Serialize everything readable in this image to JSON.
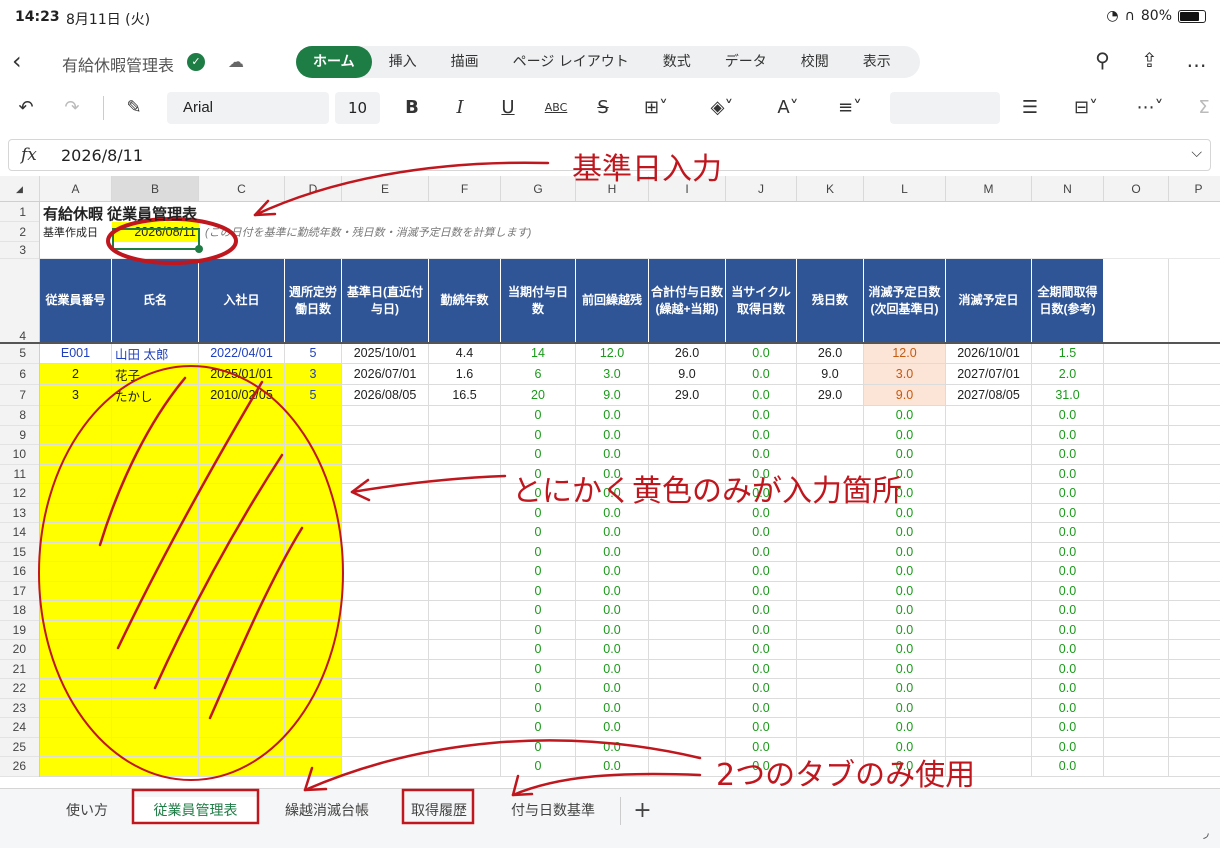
{
  "status": {
    "time": "14:23",
    "date": "8月11日 (火)",
    "battery": "80%",
    "battery_level": 0.8
  },
  "header": {
    "doc_title": "有給休暇管理表"
  },
  "ribbon": {
    "tabs": [
      "ホーム",
      "挿入",
      "描画",
      "ページ レイアウト",
      "数式",
      "データ",
      "校閲",
      "表示"
    ],
    "active_tab": "ホーム"
  },
  "toolbar": {
    "font": "Arial",
    "size": "10"
  },
  "formula_bar": {
    "fx": "fx",
    "value": "2026/8/11"
  },
  "columns": [
    "A",
    "B",
    "C",
    "D",
    "E",
    "F",
    "G",
    "H",
    "I",
    "J",
    "K",
    "L",
    "M",
    "N",
    "O",
    "P"
  ],
  "selected_column": "B",
  "sheet": {
    "title": "有給休暇 従業員管理表",
    "base_label": "基準作成日",
    "base_value": "2026/08/11",
    "base_note": "(この日付を基準に勤続年数・残日数・消滅予定日数を計算します)",
    "headers": [
      "従業員番号",
      "氏名",
      "入社日",
      "週所定労働日数",
      "基準日(直近付与日)",
      "勤続年数",
      "当期付与日数",
      "前回繰越残",
      "合計付与日数(繰越+当期)",
      "当サイクル取得日数",
      "残日数",
      "消滅予定日数(次回基準日)",
      "消滅予定日",
      "全期間取得日数(参考)"
    ],
    "employees": [
      [
        "E001",
        "山田 太郎",
        "2022/04/01",
        "5",
        "2025/10/01",
        "4.4",
        "14",
        "12.0",
        "26.0",
        "0.0",
        "26.0",
        "12.0",
        "2026/10/01",
        "1.5"
      ],
      [
        "2",
        "花子",
        "2025/01/01",
        "3",
        "2026/07/01",
        "1.6",
        "6",
        "3.0",
        "9.0",
        "0.0",
        "9.0",
        "3.0",
        "2027/07/01",
        "2.0"
      ],
      [
        "3",
        "たかし",
        "2010/02/05",
        "5",
        "2026/08/05",
        "16.5",
        "20",
        "9.0",
        "29.0",
        "0.0",
        "29.0",
        "9.0",
        "2027/08/05",
        "31.0"
      ]
    ],
    "empty_values": {
      "g": "0",
      "h": "0.0",
      "j": "0.0",
      "l": "0.0",
      "n": "0.0"
    }
  },
  "row_numbers": [
    "1",
    "2",
    "3",
    "4",
    "5",
    "6",
    "7",
    "8",
    "9",
    "10",
    "11",
    "12",
    "13",
    "14",
    "15",
    "16",
    "17",
    "18",
    "19",
    "20",
    "21",
    "22",
    "23",
    "24",
    "25",
    "26"
  ],
  "sheet_tabs": [
    "使い方",
    "従業員管理表",
    "繰越消滅台帳",
    "取得履歴",
    "付与日数基準"
  ],
  "active_sheet_tab": "従業員管理表",
  "annotations": {
    "base_date": "基準日入力",
    "yellow_only": "とにかく黄色のみが入力箇所",
    "two_tabs": "2つのタブのみ使用"
  },
  "colors": {
    "accent": "#1e7d45",
    "header_fill": "#2f5597",
    "input_fill": "#ffff00",
    "warn_fill": "#fce4d6",
    "annotation": "#c0161e"
  }
}
